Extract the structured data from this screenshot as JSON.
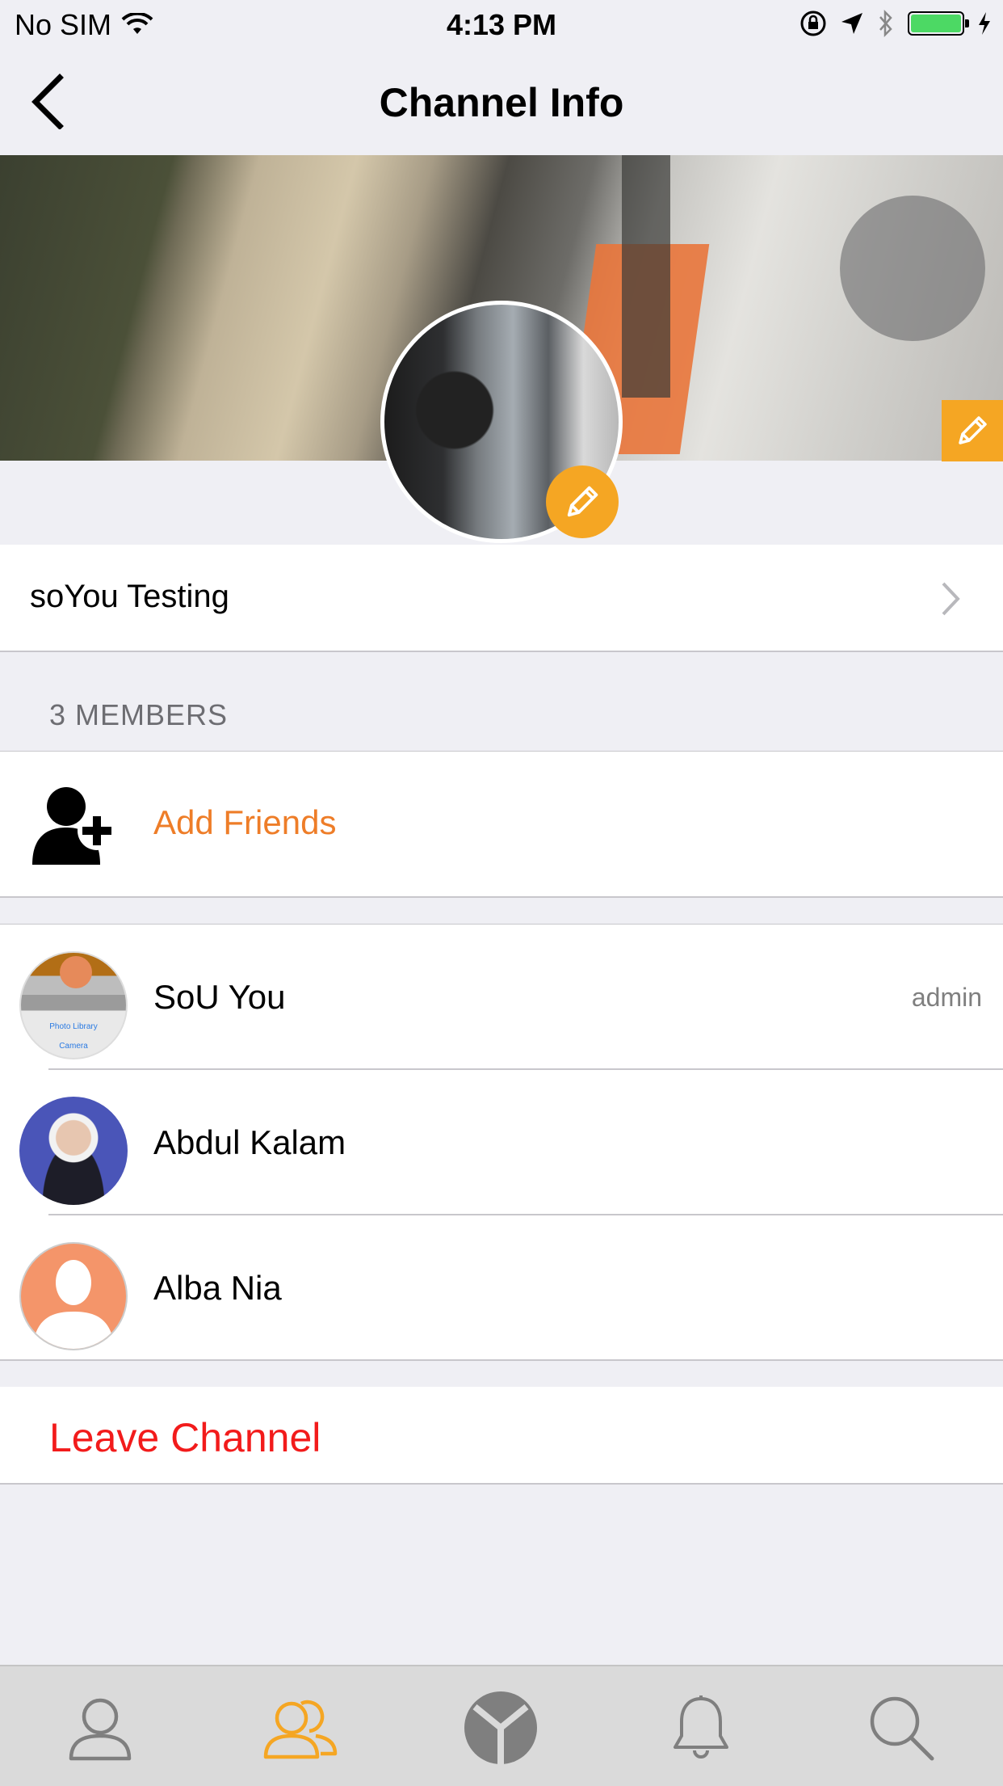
{
  "status_bar": {
    "carrier": "No SIM",
    "time": "4:13 PM",
    "battery_color": "#4cd964"
  },
  "nav": {
    "title": "Channel Info"
  },
  "channel": {
    "name": "soYou Testing"
  },
  "members_section": {
    "header": "3 MEMBERS"
  },
  "add_friends": {
    "label": "Add Friends",
    "color": "#ee7d28"
  },
  "members": [
    {
      "name": "SoU You",
      "role": "admin",
      "avatar_text": {
        "photo_library": "Photo Library",
        "camera": "Camera"
      }
    },
    {
      "name": "Abdul Kalam",
      "role": ""
    },
    {
      "name": "Alba Nia",
      "role": ""
    }
  ],
  "leave": {
    "label": "Leave Channel",
    "color": "#f21b1b"
  },
  "accent_color": "#f5a623",
  "tabs": [
    {
      "icon": "profile-icon",
      "active": false
    },
    {
      "icon": "group-icon",
      "active": true
    },
    {
      "icon": "soyou-logo-icon",
      "active": false
    },
    {
      "icon": "bell-icon",
      "active": false
    },
    {
      "icon": "search-icon",
      "active": false
    }
  ]
}
